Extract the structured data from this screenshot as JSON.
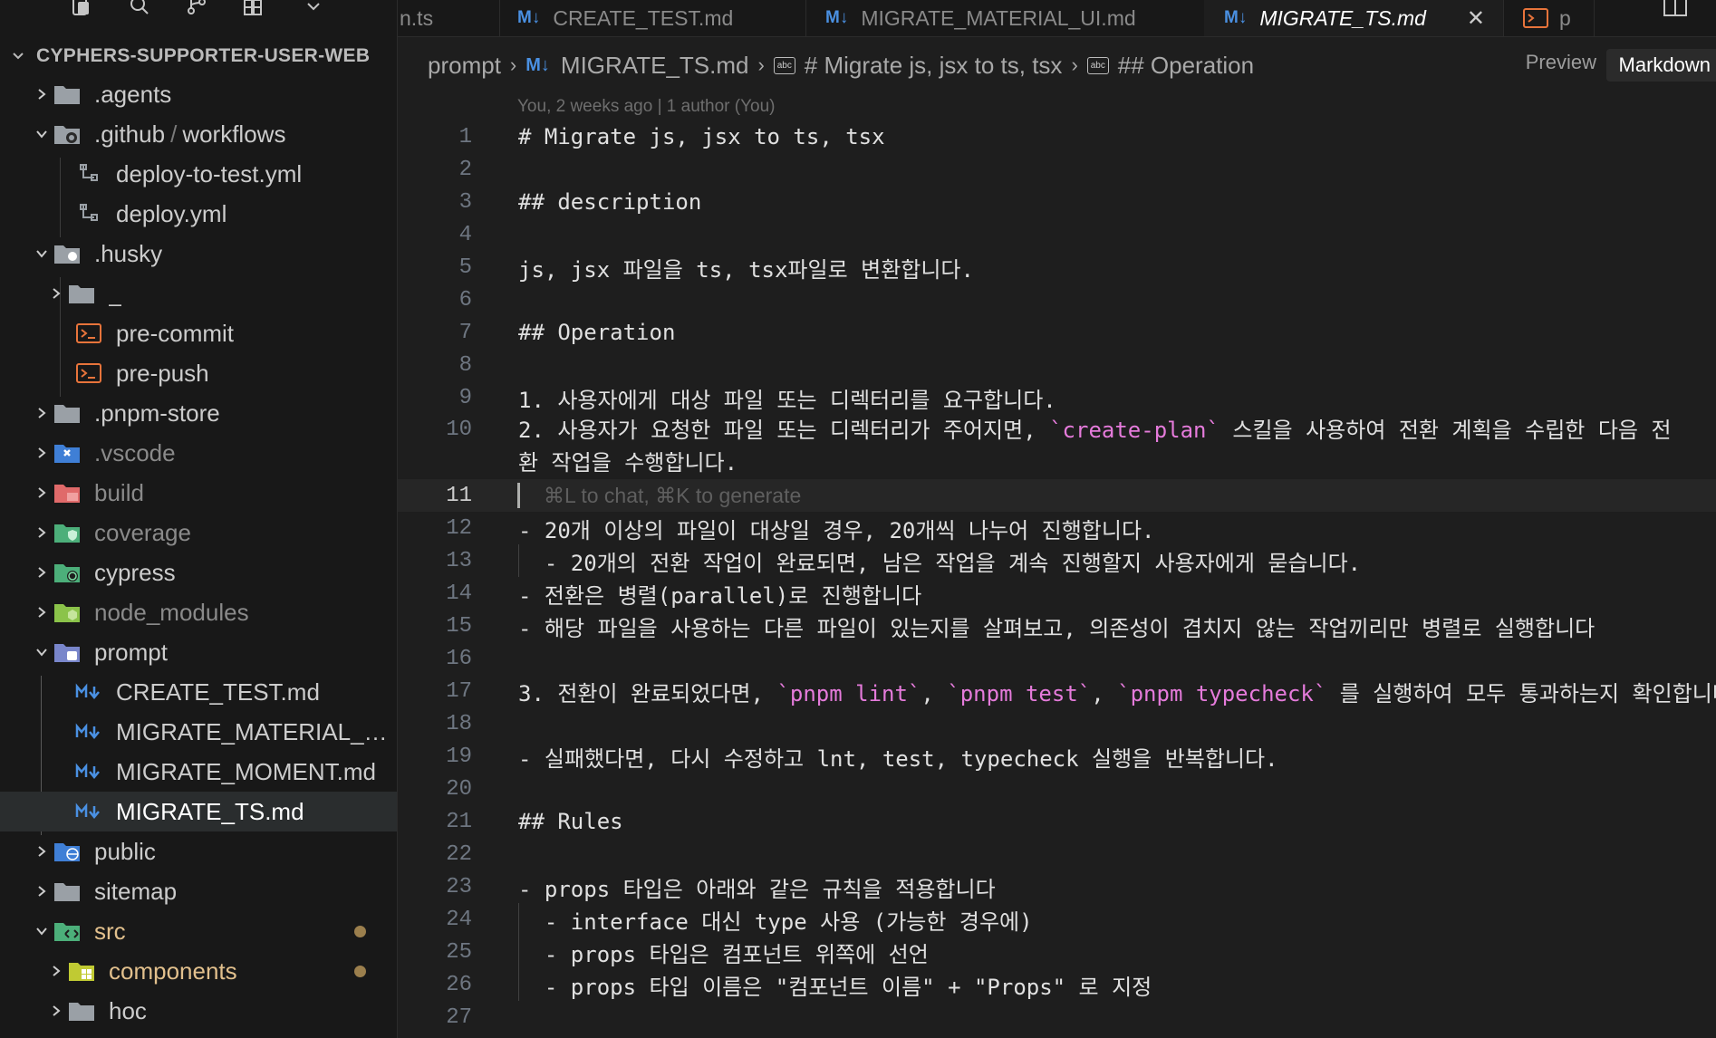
{
  "sidebar": {
    "title": "CYPHERS-SUPPORTER-USER-WEB",
    "items": [
      {
        "label": ".agents"
      },
      {
        "label": ".github",
        "label_suffix": "workflows"
      },
      {
        "label": "deploy-to-test.yml"
      },
      {
        "label": "deploy.yml"
      },
      {
        "label": ".husky"
      },
      {
        "label": "_"
      },
      {
        "label": "pre-commit"
      },
      {
        "label": "pre-push"
      },
      {
        "label": ".pnpm-store"
      },
      {
        "label": ".vscode"
      },
      {
        "label": "build"
      },
      {
        "label": "coverage"
      },
      {
        "label": "cypress"
      },
      {
        "label": "node_modules"
      },
      {
        "label": "prompt"
      },
      {
        "label": "CREATE_TEST.md"
      },
      {
        "label": "MIGRATE_MATERIAL_UI.md"
      },
      {
        "label": "MIGRATE_MOMENT.md"
      },
      {
        "label": "MIGRATE_TS.md"
      },
      {
        "label": "public"
      },
      {
        "label": "sitemap"
      },
      {
        "label": "src"
      },
      {
        "label": "components"
      },
      {
        "label": "hoc"
      }
    ]
  },
  "tabs": [
    {
      "label": "n.ts"
    },
    {
      "label": "CREATE_TEST.md"
    },
    {
      "label": "MIGRATE_MATERIAL_UI.md"
    },
    {
      "label": "MIGRATE_TS.md"
    },
    {
      "label": "p"
    }
  ],
  "breadcrumb": {
    "folder": "prompt",
    "file": "MIGRATE_TS.md",
    "h1": "# Migrate js, jsx to ts, tsx",
    "h2": "## Operation"
  },
  "view_toggle": {
    "preview": "Preview",
    "markdown": "Markdown"
  },
  "blame": "You, 2 weeks ago | 1 author (You)",
  "chat_hint": "⌘L to chat, ⌘K to generate",
  "lines": [
    {
      "n": "1",
      "text": "# Migrate js, jsx to ts, tsx"
    },
    {
      "n": "2",
      "text": ""
    },
    {
      "n": "3",
      "text": "## description"
    },
    {
      "n": "4",
      "text": ""
    },
    {
      "n": "5",
      "text": "js, jsx 파일을 ts, tsx파일로 변환합니다."
    },
    {
      "n": "6",
      "text": ""
    },
    {
      "n": "7",
      "text": "## Operation"
    },
    {
      "n": "8",
      "text": ""
    },
    {
      "n": "9",
      "text": "1. 사용자에게 대상 파일 또는 디렉터리를 요구합니다."
    },
    {
      "n": "10",
      "pre": "2. 사용자가 요청한 파일 또는 디렉터리가 주어지면, ",
      "code": "`create-plan`",
      "post": " 스킬을 사용하여 전환 계획을 수립한 다음 전환 작업을 수행합니다."
    },
    {
      "n": "11",
      "text": ""
    },
    {
      "n": "12",
      "text": "- 20개 이상의 파일이 대상일 경우, 20개씩 나누어 진행합니다."
    },
    {
      "n": "13",
      "text": "  - 20개의 전환 작업이 완료되면, 남은 작업을 계속 진행할지 사용자에게 묻습니다."
    },
    {
      "n": "14",
      "text": "- 전환은 병렬(parallel)로 진행합니다"
    },
    {
      "n": "15",
      "text": "- 해당 파일을 사용하는 다른 파일이 있는지를 살펴보고, 의존성이 겹치지 않는 작업끼리만 병렬로 실행합니다"
    },
    {
      "n": "16",
      "text": ""
    },
    {
      "n": "17",
      "pre": "3. 전환이 완료되었다면, ",
      "c1": "`pnpm lint`",
      "m1": ", ",
      "c2": "`pnpm test`",
      "m2": ", ",
      "c3": "`pnpm typecheck`",
      "post": " 를 실행하여 모두 통과하는지 확인합니다"
    },
    {
      "n": "18",
      "text": ""
    },
    {
      "n": "19",
      "text": "- 실패했다면, 다시 수정하고 lnt, test, typecheck 실행을 반복합니다."
    },
    {
      "n": "20",
      "text": ""
    },
    {
      "n": "21",
      "text": "## Rules"
    },
    {
      "n": "22",
      "text": ""
    },
    {
      "n": "23",
      "text": "- props 타입은 아래와 같은 규칙을 적용합니다"
    },
    {
      "n": "24",
      "text": "  - interface 대신 type 사용 (가능한 경우에)"
    },
    {
      "n": "25",
      "text": "  - props 타입은 컴포넌트 위쪽에 선언"
    },
    {
      "n": "26",
      "text": "  - props 타입 이름은 \"컴포넌트 이름\" + \"Props\" 로 지정"
    },
    {
      "n": "27",
      "text": ""
    }
  ],
  "colors": {
    "accent": "#4a90e2",
    "code_span": "#e57bdb",
    "modified_dot": "#9b7f4d"
  }
}
